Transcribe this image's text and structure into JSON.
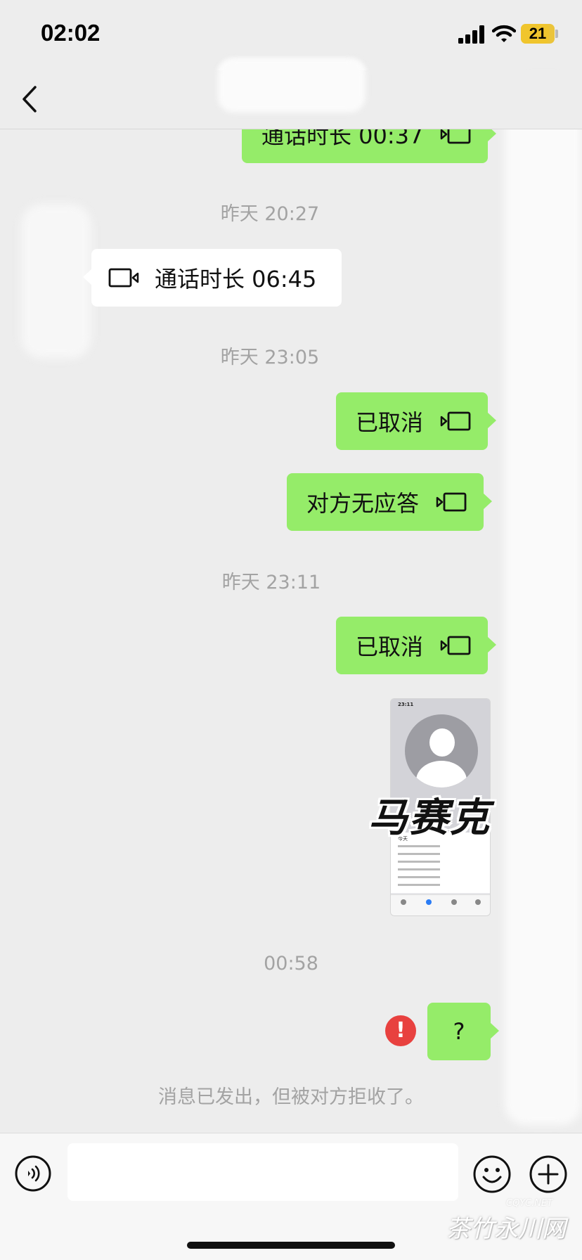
{
  "status_bar": {
    "time": "02:02",
    "battery": "21"
  },
  "messages": [
    {
      "id": "m1",
      "side": "me",
      "text": "通话时长 00:37"
    },
    {
      "id": "t1",
      "type": "timestamp",
      "text": "昨天 20:27"
    },
    {
      "id": "m2",
      "side": "them",
      "text": "通话时长 06:45"
    },
    {
      "id": "t2",
      "type": "timestamp",
      "text": "昨天 23:05"
    },
    {
      "id": "m3",
      "side": "me",
      "text": "已取消"
    },
    {
      "id": "m4",
      "side": "me",
      "text": "对方无应答"
    },
    {
      "id": "t3",
      "type": "timestamp",
      "text": "昨天 23:11"
    },
    {
      "id": "m5",
      "side": "me",
      "text": "已取消"
    },
    {
      "id": "m6",
      "side": "me",
      "type": "image",
      "mosaic_caption": "马赛克",
      "thumb_time": "23:11",
      "thumb_list_title": "今天"
    },
    {
      "id": "t4",
      "type": "timestamp",
      "text": "00:58"
    },
    {
      "id": "m7",
      "side": "me",
      "text": "?",
      "status": "failed"
    }
  ],
  "reject_note": "消息已发出，但被对方拒收了。",
  "watermark": {
    "url": "CQYC.NET",
    "text": "茶竹永川网"
  },
  "icons": [
    "back-chevron-icon",
    "video-call-icon",
    "voice-icon",
    "emoji-icon",
    "plus-icon",
    "error-icon",
    "wifi-icon",
    "signal-icon",
    "battery-icon"
  ],
  "colors": {
    "background": "#ededed",
    "my_bubble": "#95ec69",
    "their_bubble": "#ffffff",
    "error": "#e8413f",
    "timestamp": "#a3a3a3"
  }
}
